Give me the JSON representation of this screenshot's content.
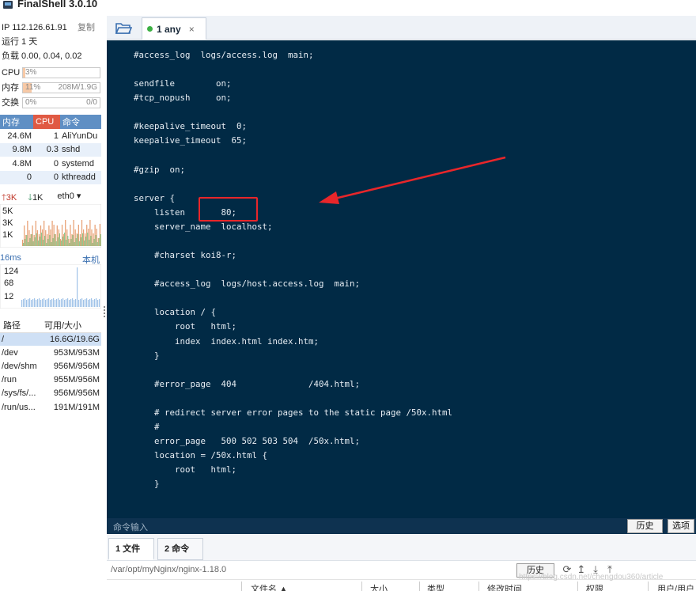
{
  "app": {
    "title": "FinalShell 3.0.10"
  },
  "server": {
    "ip_label": "IP 112.126.61.91",
    "copy_label": "复制",
    "uptime": "运行 1 天",
    "load": "负载 0.00, 0.04, 0.02"
  },
  "meters": {
    "cpu": {
      "label": "CPU",
      "value_text": "3%",
      "fraction": 0.03
    },
    "memory": {
      "label": "内存",
      "value_text": "11%",
      "detail": "208M/1.9G",
      "fraction": 0.11
    },
    "swap": {
      "label": "交换",
      "value_text": "0%",
      "detail": "0/0",
      "fraction": 0.0
    }
  },
  "processes": {
    "headers": [
      "内存",
      "CPU",
      "命令"
    ],
    "rows": [
      [
        "24.6M",
        "1",
        "AliYunDu"
      ],
      [
        "9.8M",
        "0.3",
        "sshd"
      ],
      [
        "4.8M",
        "0",
        "systemd"
      ],
      [
        "0",
        "0",
        "kthreadd"
      ]
    ]
  },
  "network": {
    "up": "3K",
    "down": "1K",
    "interface": "eth0",
    "axis": [
      "5K",
      "3K",
      "1K"
    ]
  },
  "ping": {
    "latency": "16ms",
    "target": "本机",
    "axis": [
      "124",
      "68",
      "12"
    ]
  },
  "disks": {
    "headers": [
      "路径",
      "可用/大小"
    ],
    "rows": [
      [
        "/",
        "16.6G/19.6G"
      ],
      [
        "/dev",
        "953M/953M"
      ],
      [
        "/dev/shm",
        "956M/956M"
      ],
      [
        "/run",
        "955M/956M"
      ],
      [
        "/sys/fs/...",
        "956M/956M"
      ],
      [
        "/run/us...",
        "191M/191M"
      ]
    ]
  },
  "session_tab": {
    "label": "1 any",
    "close": "×"
  },
  "terminal": {
    "lines": [
      "#access_log  logs/access.log  main;",
      "",
      "sendfile        on;",
      "#tcp_nopush     on;",
      "",
      "#keepalive_timeout  0;",
      "keepalive_timeout  65;",
      "",
      "#gzip  on;",
      "",
      "server {",
      "    listen       80;",
      "    server_name  localhost;",
      "",
      "    #charset koi8-r;",
      "",
      "    #access_log  logs/host.access.log  main;",
      "",
      "    location / {",
      "        root   html;",
      "        index  index.html index.htm;",
      "    }",
      "",
      "    #error_page  404              /404.html;",
      "",
      "    # redirect server error pages to the static page /50x.html",
      "    #",
      "    error_page   500 502 503 504  /50x.html;",
      "    location = /50x.html {",
      "        root   html;",
      "    }"
    ]
  },
  "command_bar": {
    "input_label": "命令输入",
    "history_label": "历史",
    "options_label": "选项"
  },
  "bottom_panel": {
    "tabs": [
      "1 文件",
      "2 命令"
    ],
    "path": "/var/opt/myNginx/nginx-1.18.0",
    "history_label": "历史",
    "columns": [
      "文件名 ▲",
      "大小",
      "类型",
      "修改时间",
      "权限",
      "用户/用户"
    ],
    "watermark": "https://blog.csdn.net/chengdou360/article"
  },
  "colors": {
    "terminal_bg": "#012a45",
    "annotation_red": "#e8262a",
    "proc_header_blue": "#5f8fc4",
    "proc_header_cpu": "#e05a44"
  }
}
